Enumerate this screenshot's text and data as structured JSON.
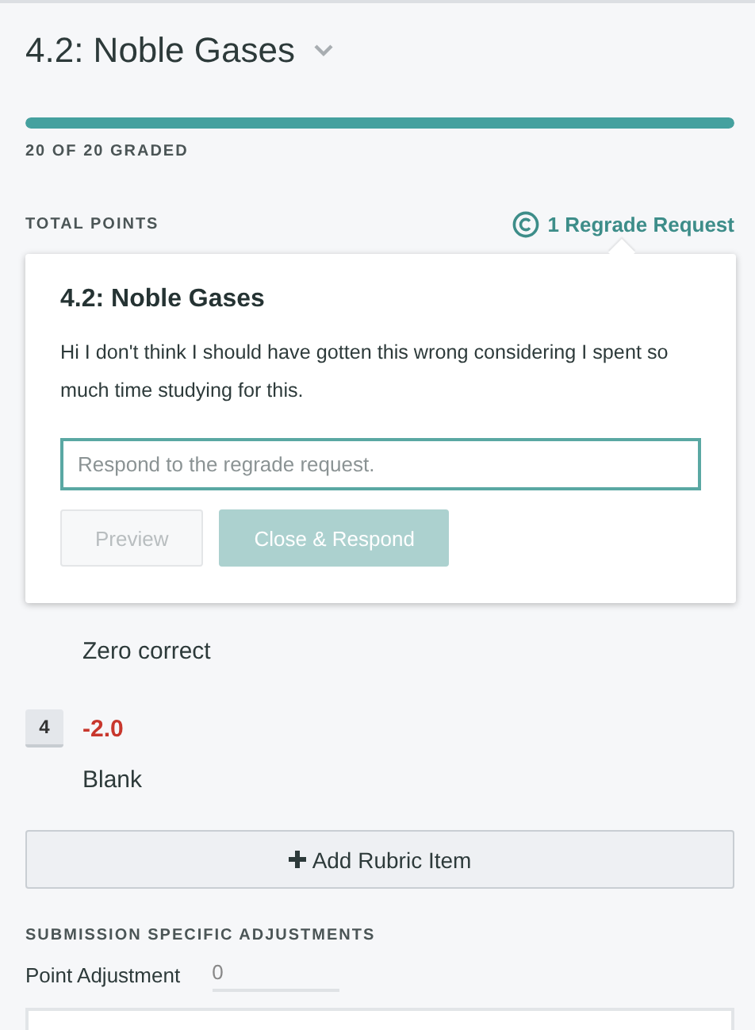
{
  "header": {
    "title": "4.2: Noble Gases"
  },
  "progress": {
    "level": 1,
    "label": "20 OF 20 GRADED"
  },
  "total": {
    "label": "TOTAL POINTS",
    "regrade_link": "1 Regrade Request"
  },
  "rubric_items": [
    {
      "description": "Zero correct"
    },
    {
      "key": "4",
      "points": "-2.0",
      "description": "Blank"
    }
  ],
  "add_button": "Add Rubric Item",
  "adjustments": {
    "heading": "SUBMISSION SPECIFIC ADJUSTMENTS",
    "label": "Point Adjustment",
    "value": "0"
  },
  "popover": {
    "title": "4.2: Noble Gases",
    "message": "Hi I don't think I should have gotten this wrong considering I spent so much time studying for this.",
    "placeholder": "Respond to the regrade request.",
    "buttons": [
      {
        "label": "Preview",
        "kind": "secondary",
        "disabled": true
      },
      {
        "label": "Close & Respond",
        "kind": "primary",
        "disabled": true
      }
    ]
  }
}
